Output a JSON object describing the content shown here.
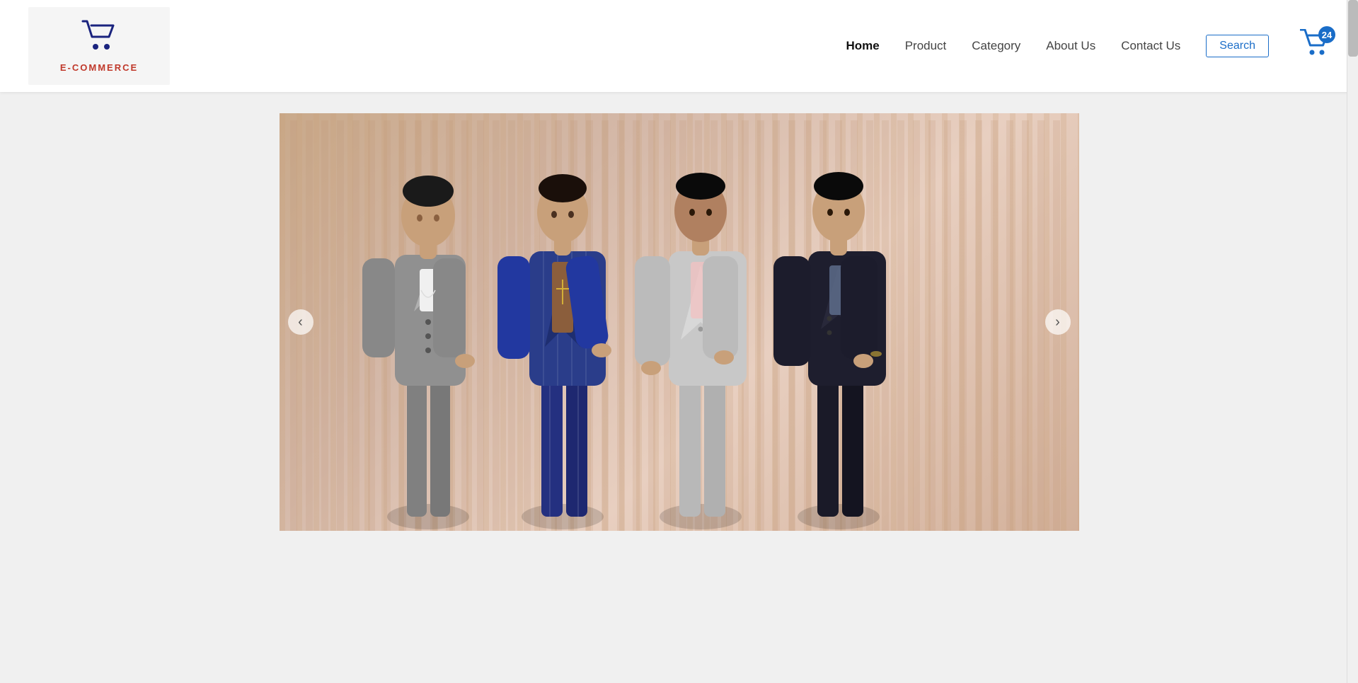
{
  "header": {
    "logo": {
      "text": "E-COMMERCE",
      "icon": "🛒"
    },
    "nav": {
      "items": [
        {
          "label": "Home",
          "active": true
        },
        {
          "label": "Product",
          "active": false
        },
        {
          "label": "Category",
          "active": false
        },
        {
          "label": "About Us",
          "active": false
        },
        {
          "label": "Contact Us",
          "active": false
        }
      ],
      "search_label": "Search",
      "cart_count": "24"
    }
  },
  "hero": {
    "prev_arrow": "‹",
    "next_arrow": "›"
  },
  "colors": {
    "nav_active": "#111111",
    "nav_default": "#555555",
    "brand_blue": "#1a6dc8",
    "logo_text": "#c0392b",
    "logo_icon": "#1a237e"
  }
}
